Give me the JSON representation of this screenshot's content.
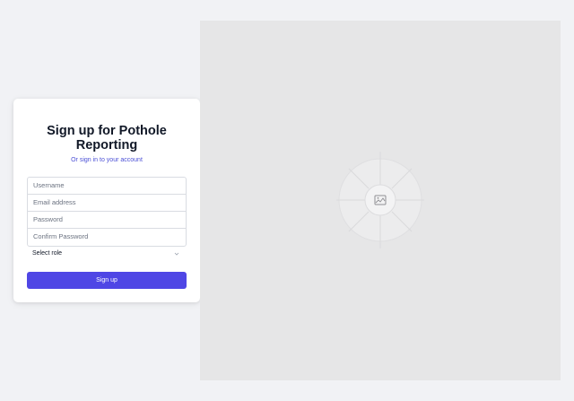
{
  "signup": {
    "title_line1": "Sign up for Pothole",
    "title_line2": "Reporting",
    "subtitle_prefix": "Or ",
    "subtitle_link": "sign in to your account",
    "fields": {
      "username_placeholder": "Username",
      "email_placeholder": "Email address",
      "password_placeholder": "Password",
      "confirm_password_placeholder": "Confirm Password"
    },
    "role_select": {
      "label": "Select role",
      "icon": "chevron-down-icon"
    },
    "submit_label": "Sign up"
  },
  "image_panel": {
    "icon": "image-icon"
  },
  "colors": {
    "page_background": "#f1f2f5",
    "card_background": "#ffffff",
    "accent": "#4f46e5",
    "link": "#4b50d6",
    "placeholder_background": "#e6e6e7"
  }
}
